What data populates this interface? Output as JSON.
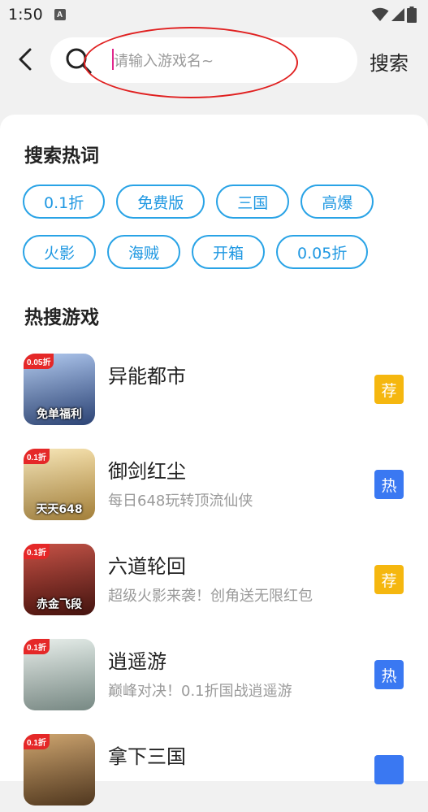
{
  "status_bar": {
    "time": "1:50",
    "a_icon": "A"
  },
  "search": {
    "placeholder": "请输入游戏名~",
    "button_label": "搜索"
  },
  "hot_words": {
    "title": "搜索热词",
    "chips": [
      "0.1折",
      "免费版",
      "三国",
      "高爆",
      "火影",
      "海贼",
      "开箱",
      "0.05折"
    ]
  },
  "hot_games": {
    "title": "热搜游戏",
    "items": [
      {
        "name": "异能都市",
        "desc": "",
        "tag": "荐",
        "tag_color": "#f5b70f",
        "icon_badge": "0.05折",
        "icon_caption": "免单福利",
        "icon_colors": [
          "#3b5a9c",
          "#a9c4ec"
        ]
      },
      {
        "name": "御剑红尘",
        "desc": "每日648玩转顶流仙侠",
        "tag": "热",
        "tag_color": "#3a78f2",
        "icon_badge": "0.1折",
        "icon_caption": "天天648",
        "icon_colors": [
          "#d9a94c",
          "#f3e2b0"
        ]
      },
      {
        "name": "六道轮回",
        "desc": "超级火影来袭！创角送无限红包",
        "tag": "荐",
        "tag_color": "#f5b70f",
        "icon_badge": "0.1折",
        "icon_caption": "赤金飞段",
        "icon_colors": [
          "#5b1a14",
          "#c0392b"
        ]
      },
      {
        "name": "逍遥游",
        "desc": "巅峰对决！0.1折国战逍遥游",
        "tag": "热",
        "tag_color": "#3a78f2",
        "icon_badge": "0.1折",
        "icon_caption": "",
        "icon_colors": [
          "#9fb7b0",
          "#e6ece8"
        ]
      },
      {
        "name": "拿下三国",
        "desc": "",
        "tag": "",
        "tag_color": "#3a78f2",
        "icon_badge": "0.1折",
        "icon_caption": "",
        "icon_colors": [
          "#6b4a2a",
          "#c99a5b"
        ]
      }
    ]
  }
}
